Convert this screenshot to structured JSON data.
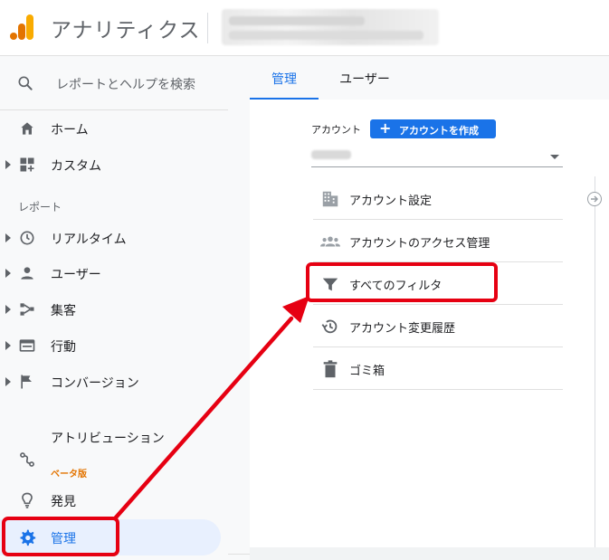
{
  "header": {
    "app_title": "アナリティクス",
    "logo_icon": "analytics-logo-icon"
  },
  "sidebar": {
    "search_placeholder": "レポートとヘルプを検索",
    "items_top": [
      {
        "label": "ホーム",
        "icon": "home-icon"
      },
      {
        "label": "カスタム",
        "icon": "dashboard-icon"
      }
    ],
    "section_label": "レポート",
    "report_items": [
      {
        "label": "リアルタイム",
        "icon": "clock-icon"
      },
      {
        "label": "ユーザー",
        "icon": "person-icon"
      },
      {
        "label": "集客",
        "icon": "acquisition-icon"
      },
      {
        "label": "行動",
        "icon": "behavior-icon"
      },
      {
        "label": "コンバージョン",
        "icon": "flag-icon"
      }
    ],
    "attribution": {
      "label": "アトリビューション",
      "badge": "ベータ版"
    },
    "discover": {
      "label": "発見"
    },
    "admin": {
      "label": "管理"
    }
  },
  "tabs": [
    {
      "label": "管理",
      "active": true
    },
    {
      "label": "ユーザー",
      "active": false
    }
  ],
  "account_panel": {
    "label": "アカウント",
    "create_button": "アカウントを作成",
    "menu": [
      {
        "label": "アカウント設定",
        "icon": "building-icon"
      },
      {
        "label": "アカウントのアクセス管理",
        "icon": "people-icon"
      },
      {
        "label": "すべてのフィルタ",
        "icon": "filter-icon"
      },
      {
        "label": "アカウント変更履歴",
        "icon": "history-icon"
      },
      {
        "label": "ゴミ箱",
        "icon": "trash-icon"
      }
    ]
  },
  "colors": {
    "accent": "#1a73e8",
    "highlight": "#e60012",
    "beta": "#e37400"
  }
}
